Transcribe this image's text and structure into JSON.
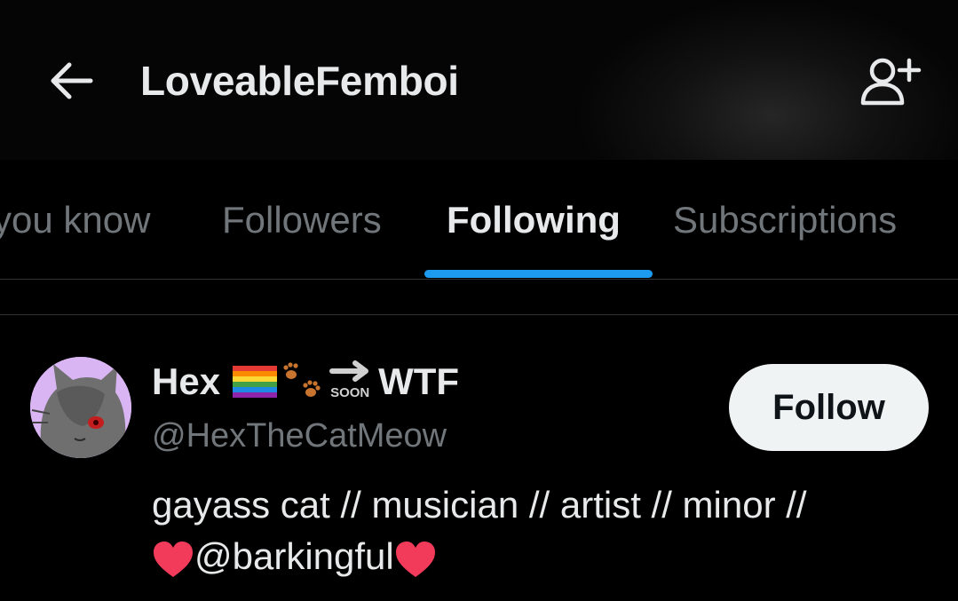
{
  "header": {
    "title": "LoveableFemboi",
    "back_icon": "arrow-left-icon",
    "add_icon": "add-user-icon"
  },
  "tabs": [
    {
      "label": "you know",
      "active": false
    },
    {
      "label": "Followers",
      "active": false
    },
    {
      "label": "Following",
      "active": true
    },
    {
      "label": "Subscriptions",
      "active": false
    }
  ],
  "accent_color": "#1d9bf0",
  "user": {
    "name": "Hex",
    "name_suffix": "WTF",
    "soon_label": "SOON",
    "handle": "@HexTheCatMeow",
    "bio_line1": "gayass cat // musician // artist // minor //",
    "bio_mention": "@barkingful",
    "follow_label": "Follow"
  }
}
